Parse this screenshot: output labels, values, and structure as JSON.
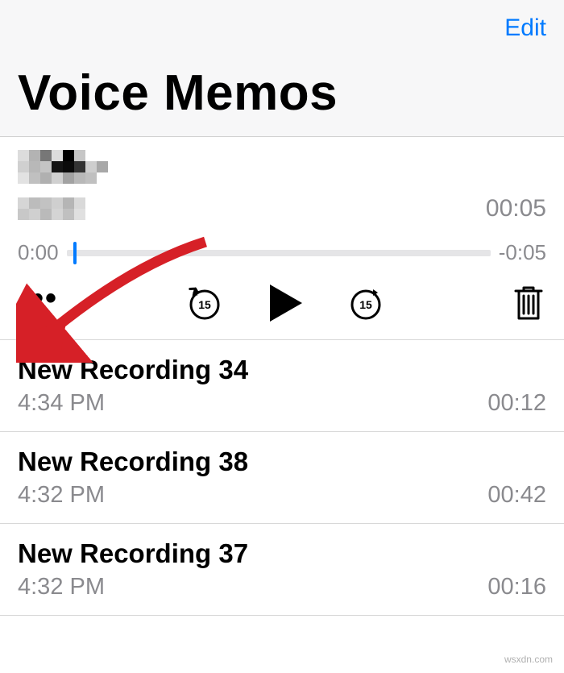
{
  "colors": {
    "accent": "#007aff",
    "arrow": "#d62027"
  },
  "header": {
    "edit_label": "Edit",
    "title": "Voice Memos"
  },
  "expanded": {
    "duration": "00:05",
    "time_left": "0:00",
    "time_right": "-0:05",
    "more_icon": "more-icon",
    "skip_back": "15",
    "skip_forward": "15"
  },
  "recordings": [
    {
      "title": "New Recording 34",
      "time": "4:34 PM",
      "duration": "00:12"
    },
    {
      "title": "New Recording 38",
      "time": "4:32 PM",
      "duration": "00:42"
    },
    {
      "title": "New Recording 37",
      "time": "4:32 PM",
      "duration": "00:16"
    }
  ],
  "watermark": "wsxdn.com"
}
